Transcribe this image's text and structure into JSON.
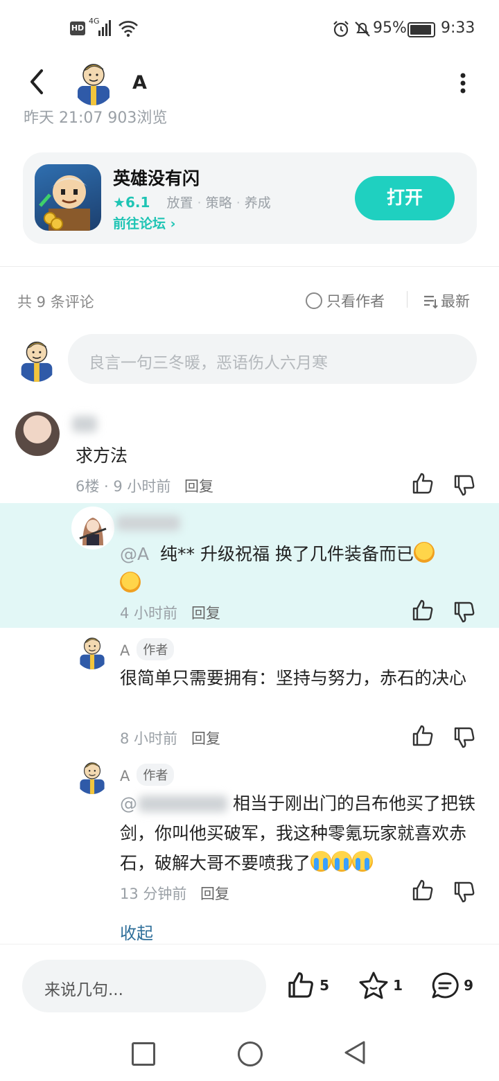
{
  "status_bar": {
    "hd": "HD",
    "network": "4G",
    "battery_percent": "95%",
    "time": "9:33"
  },
  "header": {
    "title": "A"
  },
  "post_meta": {
    "faded_text": "昨天 21:07  903浏览"
  },
  "game_card": {
    "name": "英雄没有闪",
    "rating": "6.1",
    "tags": [
      "放置",
      "策略",
      "养成"
    ],
    "forum_link": "前往论坛",
    "open_label": "打开"
  },
  "comments_header": {
    "count_label": "共 9 条评论",
    "author_only_label": "只看作者",
    "sort_label": "最新"
  },
  "comment_input": {
    "placeholder": "良言一句三冬暖，恶语伤人六月寒"
  },
  "comments": [
    {
      "text": "求方法",
      "meta": "6楼 · 9 小时前",
      "reply_label": "回复"
    }
  ],
  "replies": [
    {
      "mention": "@A",
      "text": "纯** 升级祝福 换了几件装备而已",
      "meta": "4 小时前",
      "reply_label": "回复",
      "highlighted": true
    },
    {
      "author": "A",
      "badge": "作者",
      "text": "很简单只需要拥有：坚持与努力，赤石的决心",
      "meta": "8 小时前",
      "reply_label": "回复"
    },
    {
      "author": "A",
      "badge": "作者",
      "mention_prefix": "@",
      "text": "相当于刚出门的吕布他买了把铁剑，你叫他买破军，我这种零氪玩家就喜欢赤石，破解大哥不要喷我了",
      "meta": "13 分钟前",
      "reply_label": "回复"
    }
  ],
  "collapse_label": "收起",
  "bottom_bar": {
    "input_placeholder": "来说几句...",
    "like_count": "5",
    "star_count": "1",
    "comment_count": "9"
  },
  "colors": {
    "accent": "#1fd0c0",
    "highlight_bg": "#e2f7f6",
    "link": "#2f6f9a"
  }
}
